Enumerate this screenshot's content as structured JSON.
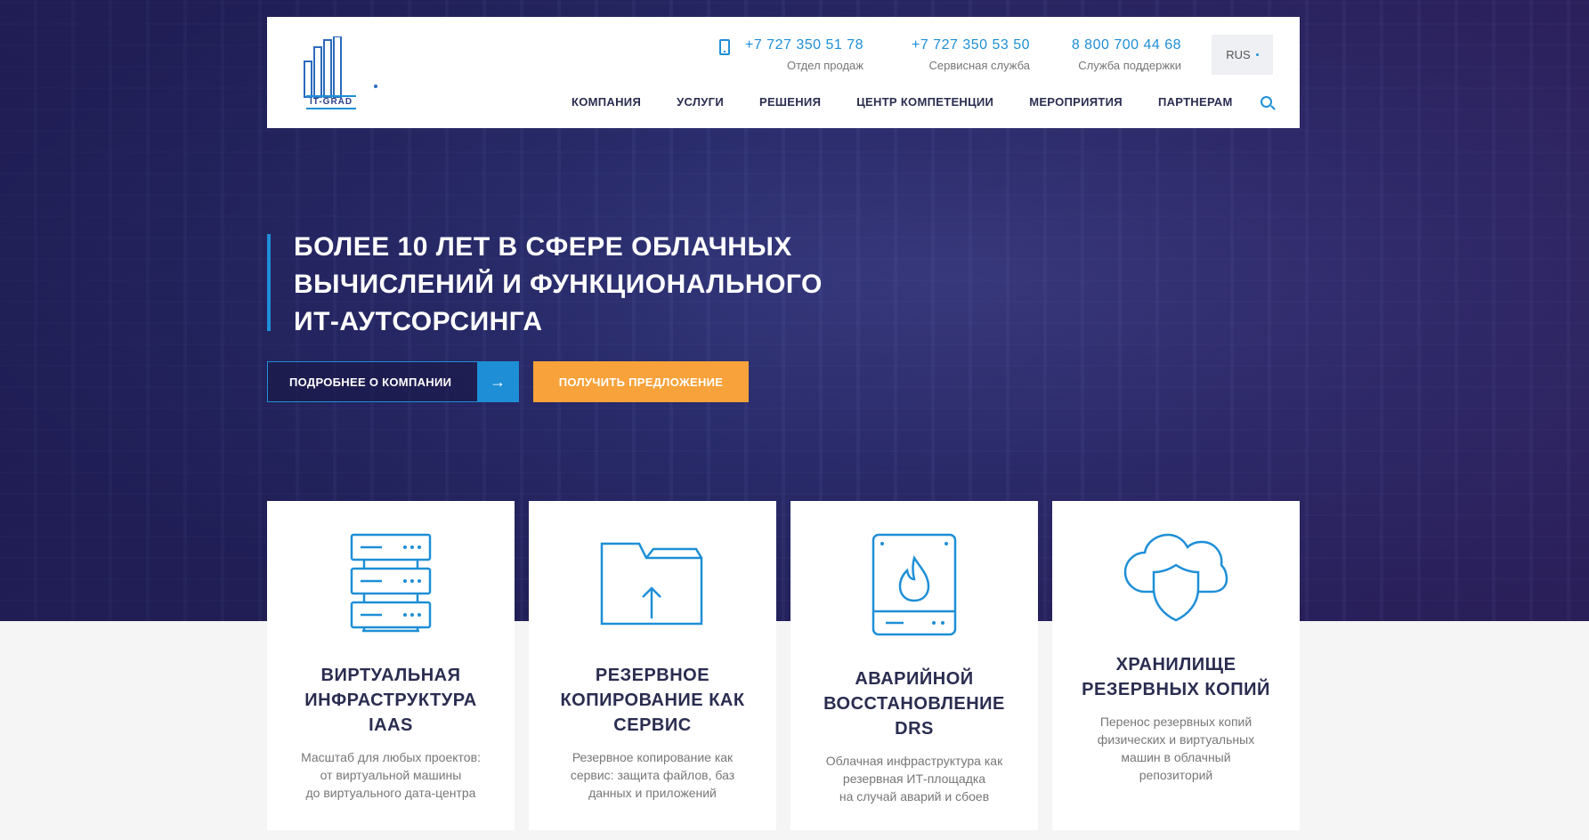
{
  "header": {
    "logo_text": "IT-GRAD",
    "phones": [
      {
        "number": "+7 727 350 51 78",
        "label": "Отдел продаж"
      },
      {
        "number": "+7 727 350 53 50",
        "label": "Сервисная служба"
      },
      {
        "number": "8 800 700 44 68",
        "label": "Служба поддержки"
      }
    ],
    "lang": "RUS",
    "nav": [
      "КОМПАНИЯ",
      "УСЛУГИ",
      "РЕШЕНИЯ",
      "ЦЕНТР КОМПЕТЕНЦИИ",
      "МЕРОПРИЯТИЯ",
      "ПАРТНЕРАМ"
    ]
  },
  "hero": {
    "title_lines": [
      "БОЛЕЕ 10 ЛЕТ В СФЕРЕ ОБЛАЧНЫХ",
      "ВЫЧИСЛЕНИЙ И ФУНКЦИОНАЛЬНОГО",
      "ИТ-АУТСОРСИНГА"
    ],
    "btn_company": "ПОДРОБНЕЕ О КОМПАНИИ",
    "btn_company_arrow": "→",
    "btn_offer": "ПОЛУЧИТЬ ПРЕДЛОЖЕНИЕ"
  },
  "cards": [
    {
      "icon": "server-rack-icon",
      "title_lines": [
        "ВИРТУАЛЬНАЯ",
        "ИНФРАСТРУКТУРА",
        "IAAS"
      ],
      "desc_lines": [
        "Масштаб для любых проектов:",
        "от виртуальной машины",
        "до виртуального дата-центра"
      ]
    },
    {
      "icon": "folder-upload-icon",
      "title_lines": [
        "РЕЗЕРВНОЕ",
        "КОПИРОВАНИЕ КАК",
        "СЕРВИС"
      ],
      "desc_lines": [
        "Резервное копирование как",
        "сервис: защита файлов, баз",
        "данных и приложений"
      ]
    },
    {
      "icon": "disk-fire-icon",
      "title_lines": [
        "АВАРИЙНОЙ",
        "ВОССТАНОВЛЕНИЕ DRS"
      ],
      "desc_lines": [
        "Облачная инфраструктура как",
        "резервная ИТ-площадка",
        "на случай аварий и сбоев"
      ]
    },
    {
      "icon": "cloud-shield-icon",
      "title_lines": [
        "ХРАНИЛИЩЕ",
        "РЕЗЕРВНЫХ КОПИЙ"
      ],
      "desc_lines": [
        "Перенос резервных копий",
        "физических и виртуальных",
        "машин в облачный",
        "репозиторий"
      ]
    }
  ],
  "colors": {
    "accent": "#1e8fd6",
    "offer": "#f7a23a",
    "dark_text": "#2a2d50",
    "hero_bg": "#2a2d6e"
  }
}
